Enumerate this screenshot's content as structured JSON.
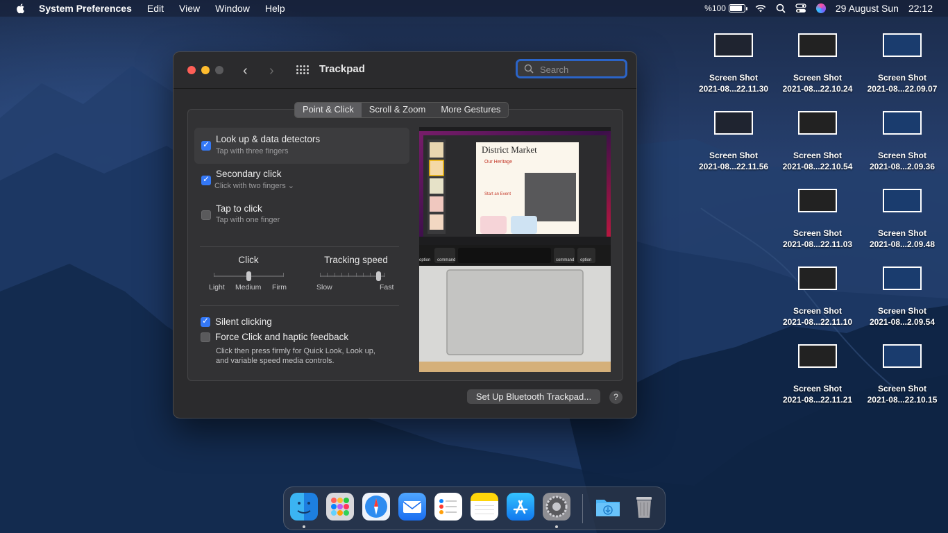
{
  "menubar": {
    "app_name": "System Preferences",
    "menus": [
      "Edit",
      "View",
      "Window",
      "Help"
    ],
    "battery": "%100",
    "battery_level_percent": 100,
    "date": "29 August Sun",
    "time": "22:12"
  },
  "window": {
    "title": "Trackpad",
    "search": {
      "placeholder": "Search"
    },
    "tabs": [
      "Point & Click",
      "Scroll & Zoom",
      "More Gestures"
    ],
    "active_tab": "Point & Click",
    "options": [
      {
        "label": "Look up & data detectors",
        "sub": "Tap with three fingers",
        "checked": true
      },
      {
        "label": "Secondary click",
        "sub": "Click with two fingers ⌄",
        "checked": true
      },
      {
        "label": "Tap to click",
        "sub": "Tap with one finger",
        "checked": false
      }
    ],
    "click_slider": {
      "title": "Click",
      "labels": [
        "Light",
        "Medium",
        "Firm"
      ],
      "value": "Medium"
    },
    "tracking_slider": {
      "title": "Tracking speed",
      "labels": [
        "Slow",
        "Fast"
      ],
      "value_fraction": 0.9
    },
    "silent_clicking": {
      "label": "Silent clicking",
      "checked": true
    },
    "force_click": {
      "label": "Force Click and haptic feedback",
      "checked": false,
      "description": [
        "Click then press firmly for Quick Look, Look up,",
        "and variable speed media controls."
      ]
    },
    "preview": {
      "doc_title": "District Market",
      "heading": "Our Heritage",
      "subheading": "Start an Event",
      "keys": [
        "option",
        "command",
        "command",
        "option"
      ]
    },
    "bluetooth_button": "Set Up Bluetooth Trackpad...",
    "help_button": "?"
  },
  "desktop_icons": [
    {
      "title": "Screen Shot",
      "subtitle": "2021-08...22.11.30"
    },
    {
      "title": "Screen Shot",
      "subtitle": "2021-08...22.10.24"
    },
    {
      "title": "Screen Shot",
      "subtitle": "2021-08...22.09.07"
    },
    {
      "title": "Screen Shot",
      "subtitle": "2021-08...22.11.56"
    },
    {
      "title": "Screen Shot",
      "subtitle": "2021-08...22.10.54"
    },
    {
      "title": "Screen Shot",
      "subtitle": "2021-08...2.09.36"
    },
    {
      "title": "Screen Shot",
      "subtitle": "2021-08...22.11.03"
    },
    {
      "title": "Screen Shot",
      "subtitle": "2021-08...2.09.48"
    },
    {
      "title": "Screen Shot",
      "subtitle": "2021-08...22.11.10"
    },
    {
      "title": "Screen Shot",
      "subtitle": "2021-08...2.09.54"
    },
    {
      "title": "Screen Shot",
      "subtitle": "2021-08...22.11.21"
    },
    {
      "title": "Screen Shot",
      "subtitle": "2021-08...22.10.15"
    }
  ],
  "dock": {
    "apps": [
      "finder-icon",
      "launchpad-icon",
      "safari-icon",
      "mail-icon",
      "reminders-icon",
      "notes-icon",
      "app-store-icon",
      "system-preferences-icon",
      "downloads-folder-icon",
      "trash-icon"
    ],
    "running": [
      "finder-icon",
      "system-preferences-icon"
    ]
  },
  "colors": {
    "accent": "#3478f6",
    "search_focus": "#2b64c8",
    "window_bg": "#2b2b2d"
  }
}
